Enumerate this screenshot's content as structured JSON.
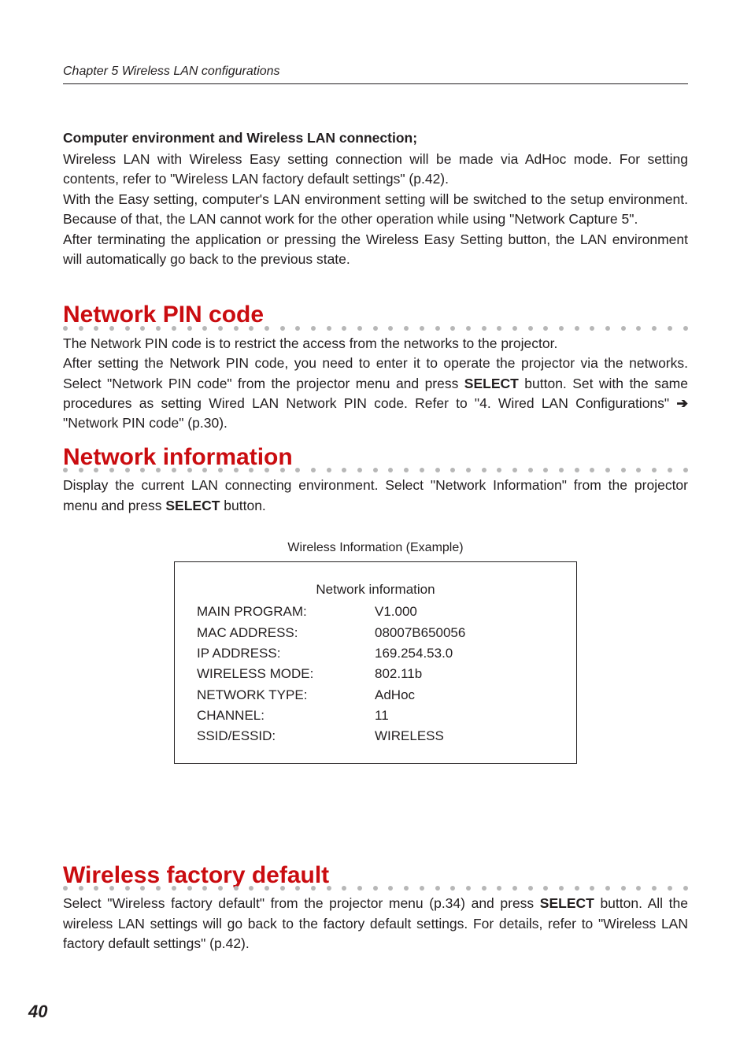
{
  "header": {
    "chapter": "Chapter 5 Wireless LAN configurations"
  },
  "section1": {
    "heading": "Computer environment and Wireless LAN connection;",
    "p1": "Wireless LAN with Wireless Easy setting connection will be made via AdHoc mode.  For setting contents, refer to \"Wireless LAN factory default settings\" (p.42).",
    "p2": "With the Easy setting, computer's LAN environment setting will be switched to the setup environment. Because of that, the LAN cannot work for the other operation while using \"Network Capture 5\".",
    "p3": "After terminating the application or pressing the Wireless Easy Setting button, the LAN environment will automatically go back to the previous state."
  },
  "section2": {
    "title": "Network PIN code",
    "p1": "The Network PIN code is to restrict the access from the networks to the projector.",
    "p2a": "After setting the Network PIN code, you need to enter it to operate the projector via the networks. Select \"Network PIN code\" from the projector menu and press ",
    "p2b": "SELECT",
    "p2c": " button. Set with the same procedures as setting Wired LAN Network PIN code. Refer to \"4. Wired LAN Configurations\" ",
    "p2arrow": "➔",
    "p2d": " \"Network PIN code\" (p.30)."
  },
  "section3": {
    "title": "Network information",
    "p1a": "Display the current LAN connecting environment. Select \"Network Information\" from the projector menu and press ",
    "p1b": "SELECT",
    "p1c": " button."
  },
  "infobox": {
    "caption": "Wireless Information (Example)",
    "title": "Network information",
    "rows": [
      {
        "label": "MAIN PROGRAM:",
        "value": "V1.000"
      },
      {
        "label": "MAC ADDRESS:",
        "value": "08007B650056"
      },
      {
        "label": "IP ADDRESS:",
        "value": "169.254.53.0"
      },
      {
        "label": "WIRELESS MODE:",
        "value": "802.11b"
      },
      {
        "label": "NETWORK TYPE:",
        "value": "AdHoc"
      },
      {
        "label": "CHANNEL:",
        "value": "11"
      },
      {
        "label": "SSID/ESSID:",
        "value": "WIRELESS"
      }
    ]
  },
  "section4": {
    "title": "Wireless factory default",
    "p1a": "Select \"Wireless factory default\" from the projector menu (p.34) and press ",
    "p1b": "SELECT",
    "p1c": " button.  All the wireless LAN settings will go back to the factory default settings. For details, refer to \"Wireless LAN factory default settings\" (p.42)."
  },
  "pagenum": "40"
}
